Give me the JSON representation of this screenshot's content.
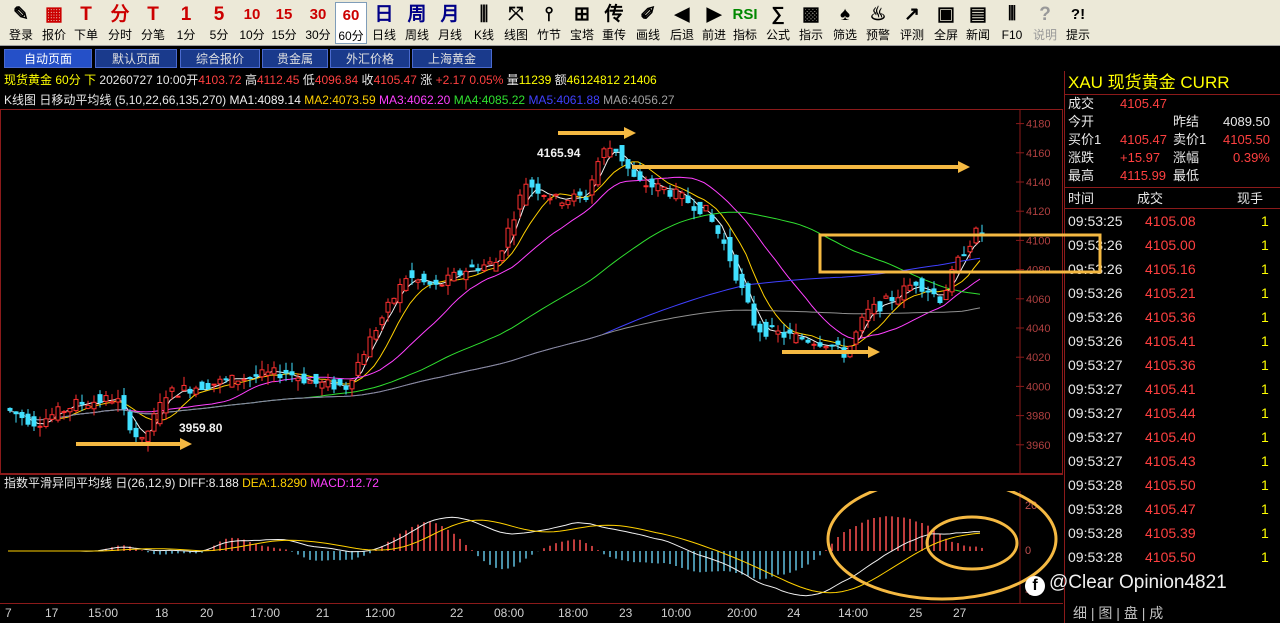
{
  "toolbar": [
    {
      "icon": "✎",
      "label": "登录",
      "name": "login"
    },
    {
      "icon": "▦",
      "label": "报价",
      "name": "quote"
    },
    {
      "icon": "T",
      "label": "下单",
      "name": "order"
    },
    {
      "icon": "分",
      "label": "分时",
      "name": "intraday"
    },
    {
      "icon": "T",
      "label": "分笔",
      "name": "ticks"
    },
    {
      "icon": "1",
      "label": "1分",
      "name": "1min"
    },
    {
      "icon": "5",
      "label": "5分",
      "name": "5min"
    },
    {
      "icon": "10",
      "label": "10分",
      "name": "10min"
    },
    {
      "icon": "15",
      "label": "15分",
      "name": "15min"
    },
    {
      "icon": "30",
      "label": "30分",
      "name": "30min"
    },
    {
      "icon": "60",
      "label": "60分",
      "name": "60min"
    },
    {
      "icon": "日",
      "label": "日线",
      "name": "daily"
    },
    {
      "icon": "周",
      "label": "周线",
      "name": "weekly"
    },
    {
      "icon": "月",
      "label": "月线",
      "name": "monthly"
    },
    {
      "icon": "⫼",
      "label": "K线",
      "name": "kline"
    },
    {
      "icon": "⤧",
      "label": "线图",
      "name": "linechart"
    },
    {
      "icon": "⫯",
      "label": "竹节",
      "name": "bamboo"
    },
    {
      "icon": "⊞",
      "label": "宝塔",
      "name": "tower"
    },
    {
      "icon": "传",
      "label": "重传",
      "name": "resend"
    },
    {
      "icon": "✐",
      "label": "画线",
      "name": "draw"
    },
    {
      "icon": "◀",
      "label": "后退",
      "name": "back"
    },
    {
      "icon": "▶",
      "label": "前进",
      "name": "forward"
    },
    {
      "icon": "RSI",
      "label": "指标",
      "name": "indicator"
    },
    {
      "icon": "∑",
      "label": "公式",
      "name": "formula"
    },
    {
      "icon": "▩",
      "label": "指示",
      "name": "signal"
    },
    {
      "icon": "♠",
      "label": "筛选",
      "name": "filter"
    },
    {
      "icon": "♨",
      "label": "预警",
      "name": "alert"
    },
    {
      "icon": "↗",
      "label": "评测",
      "name": "evaluate"
    },
    {
      "icon": "▣",
      "label": "全屏",
      "name": "fullscreen"
    },
    {
      "icon": "▤",
      "label": "新闻",
      "name": "news"
    },
    {
      "icon": "⦀",
      "label": "F10",
      "name": "f10"
    },
    {
      "icon": "?",
      "label": "说明",
      "name": "help-disabled"
    },
    {
      "icon": "?!",
      "label": "提示",
      "name": "tips"
    }
  ],
  "tabs": [
    "自动页面",
    "默认页面",
    "综合报价",
    "贵金属",
    "外汇价格",
    "上海黄金"
  ],
  "info": {
    "symbol": "现货黄金",
    "period": "60分",
    "direction": "下",
    "datetime": "20260727 10:00",
    "open_label": "开",
    "open": "4103.72",
    "high_label": "高",
    "high": "4112.45",
    "low_label": "低",
    "low": "4096.84",
    "close_label": "收",
    "close": "4105.47",
    "change_label": "涨",
    "change": "+2.17",
    "change_pct": "0.05%",
    "volume_label": "量",
    "volume": "11239",
    "amount_label": "额",
    "amount": "46124812",
    "extra": "21406"
  },
  "ma_line": {
    "title": "K线图",
    "checkbox": "日",
    "name": "移动平均线",
    "params": "(5,10,22,66,135,270)",
    "ma1": "MA1:4089.14",
    "ma2": "MA2:4073.59",
    "ma3": "MA3:4062.20",
    "ma4": "MA4:4085.22",
    "ma5": "MA5:4061.88",
    "ma6": "MA6:4056.27"
  },
  "macd_header": {
    "name": "指数平滑异同平均线",
    "checkbox": "日",
    "params": "(26,12,9)",
    "diff": "DIFF:8.188",
    "dea": "DEA:1.8290",
    "macd": "MACD:12.72"
  },
  "macd_axis": {
    "top": "20",
    "zero": "0",
    "bottom": "-20",
    "unit": "千"
  },
  "annotations": {
    "high": "4165.94",
    "low": "3959.80"
  },
  "x_labels": [
    "7",
    "17",
    "15:00",
    "18",
    "20",
    "17:00",
    "21",
    "12:00",
    "22",
    "08:00",
    "18:00",
    "23",
    "10:00",
    "20:00",
    "24",
    "14:00",
    "25",
    "27"
  ],
  "chart_data": {
    "type": "candlestick",
    "y_ticks": [
      3960,
      3980,
      4000,
      4020,
      4040,
      4060,
      4080,
      4100,
      4120,
      4140,
      4160,
      4180
    ],
    "ylim": [
      3940,
      4190
    ],
    "high": 4165.94,
    "low": 3959.8
  },
  "right_panel": {
    "title": "XAU 现货黄金 CURR",
    "deal_label": "成交",
    "deal": "4105.47",
    "open_label": "今开",
    "prev_close_label": "昨结",
    "prev_close": "4089.50",
    "bid_label": "买价1",
    "bid": "4105.47",
    "ask_label": "卖价1",
    "ask": "4105.50",
    "change_label": "涨跌",
    "change": "+15.97",
    "amp_label": "涨幅",
    "amp": "0.39%",
    "high_label": "最高",
    "high": "4115.99",
    "low_label": "最低",
    "ticks_header": {
      "time": "时间",
      "price": "成交",
      "vol": "现手"
    },
    "ticks": [
      {
        "time": "09:53:25",
        "price": "4105.08",
        "vol": "1"
      },
      {
        "time": "09:53:26",
        "price": "4105.00",
        "vol": "1"
      },
      {
        "time": "09:53:26",
        "price": "4105.16",
        "vol": "1"
      },
      {
        "time": "09:53:26",
        "price": "4105.21",
        "vol": "1"
      },
      {
        "time": "09:53:26",
        "price": "4105.36",
        "vol": "1"
      },
      {
        "time": "09:53:26",
        "price": "4105.41",
        "vol": "1"
      },
      {
        "time": "09:53:27",
        "price": "4105.36",
        "vol": "1"
      },
      {
        "time": "09:53:27",
        "price": "4105.41",
        "vol": "1"
      },
      {
        "time": "09:53:27",
        "price": "4105.44",
        "vol": "1"
      },
      {
        "time": "09:53:27",
        "price": "4105.40",
        "vol": "1"
      },
      {
        "time": "09:53:27",
        "price": "4105.43",
        "vol": "1"
      },
      {
        "time": "09:53:28",
        "price": "4105.50",
        "vol": "1"
      },
      {
        "time": "09:53:28",
        "price": "4105.47",
        "vol": "1"
      },
      {
        "time": "09:53:28",
        "price": "4105.39",
        "vol": "1"
      },
      {
        "time": "09:53:28",
        "price": "4105.50",
        "vol": "1"
      }
    ],
    "bottom_tabs": "细 | 图 | 盘 | 成"
  },
  "watermark": "@Clear Opinion4821",
  "colors": {
    "up": "#ff3030",
    "down": "#40e0ff",
    "annotation": "#f5b942"
  }
}
